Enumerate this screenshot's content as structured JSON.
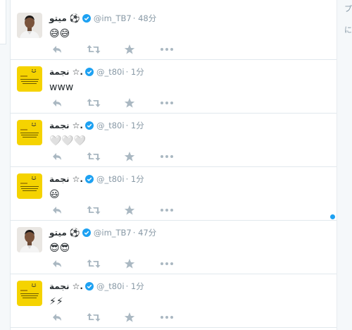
{
  "tweets": [
    {
      "name": "ميتو ⚽️",
      "handle": "@im_TB7",
      "time": "48分",
      "text": "😅😅",
      "avatar": "person"
    },
    {
      "name": "نجمة ☆.",
      "handle": "@_t80i",
      "time": "1分",
      "text": "www",
      "avatar": "yellow"
    },
    {
      "name": "نجمة ☆.",
      "handle": "@_t80i",
      "time": "1分",
      "text": "🤍🤍🤍",
      "avatar": "yellow"
    },
    {
      "name": "نجمة ☆.",
      "handle": "@_t80i",
      "time": "1分",
      "text": "😃",
      "avatar": "yellow"
    },
    {
      "name": "ميتو ⚽️",
      "handle": "@im_TB7",
      "time": "47分",
      "text": "😎😎",
      "avatar": "person"
    },
    {
      "name": "نجمة ☆.",
      "handle": "@_t80i",
      "time": "1分",
      "text": "⚡⚡",
      "avatar": "yellow"
    }
  ],
  "right_panel": {
    "line1": "プ",
    "line2": "に"
  },
  "colors": {
    "accent": "#1da1f2",
    "action_gray": "#aab8c2",
    "yellow_avatar": "#f5d300"
  }
}
